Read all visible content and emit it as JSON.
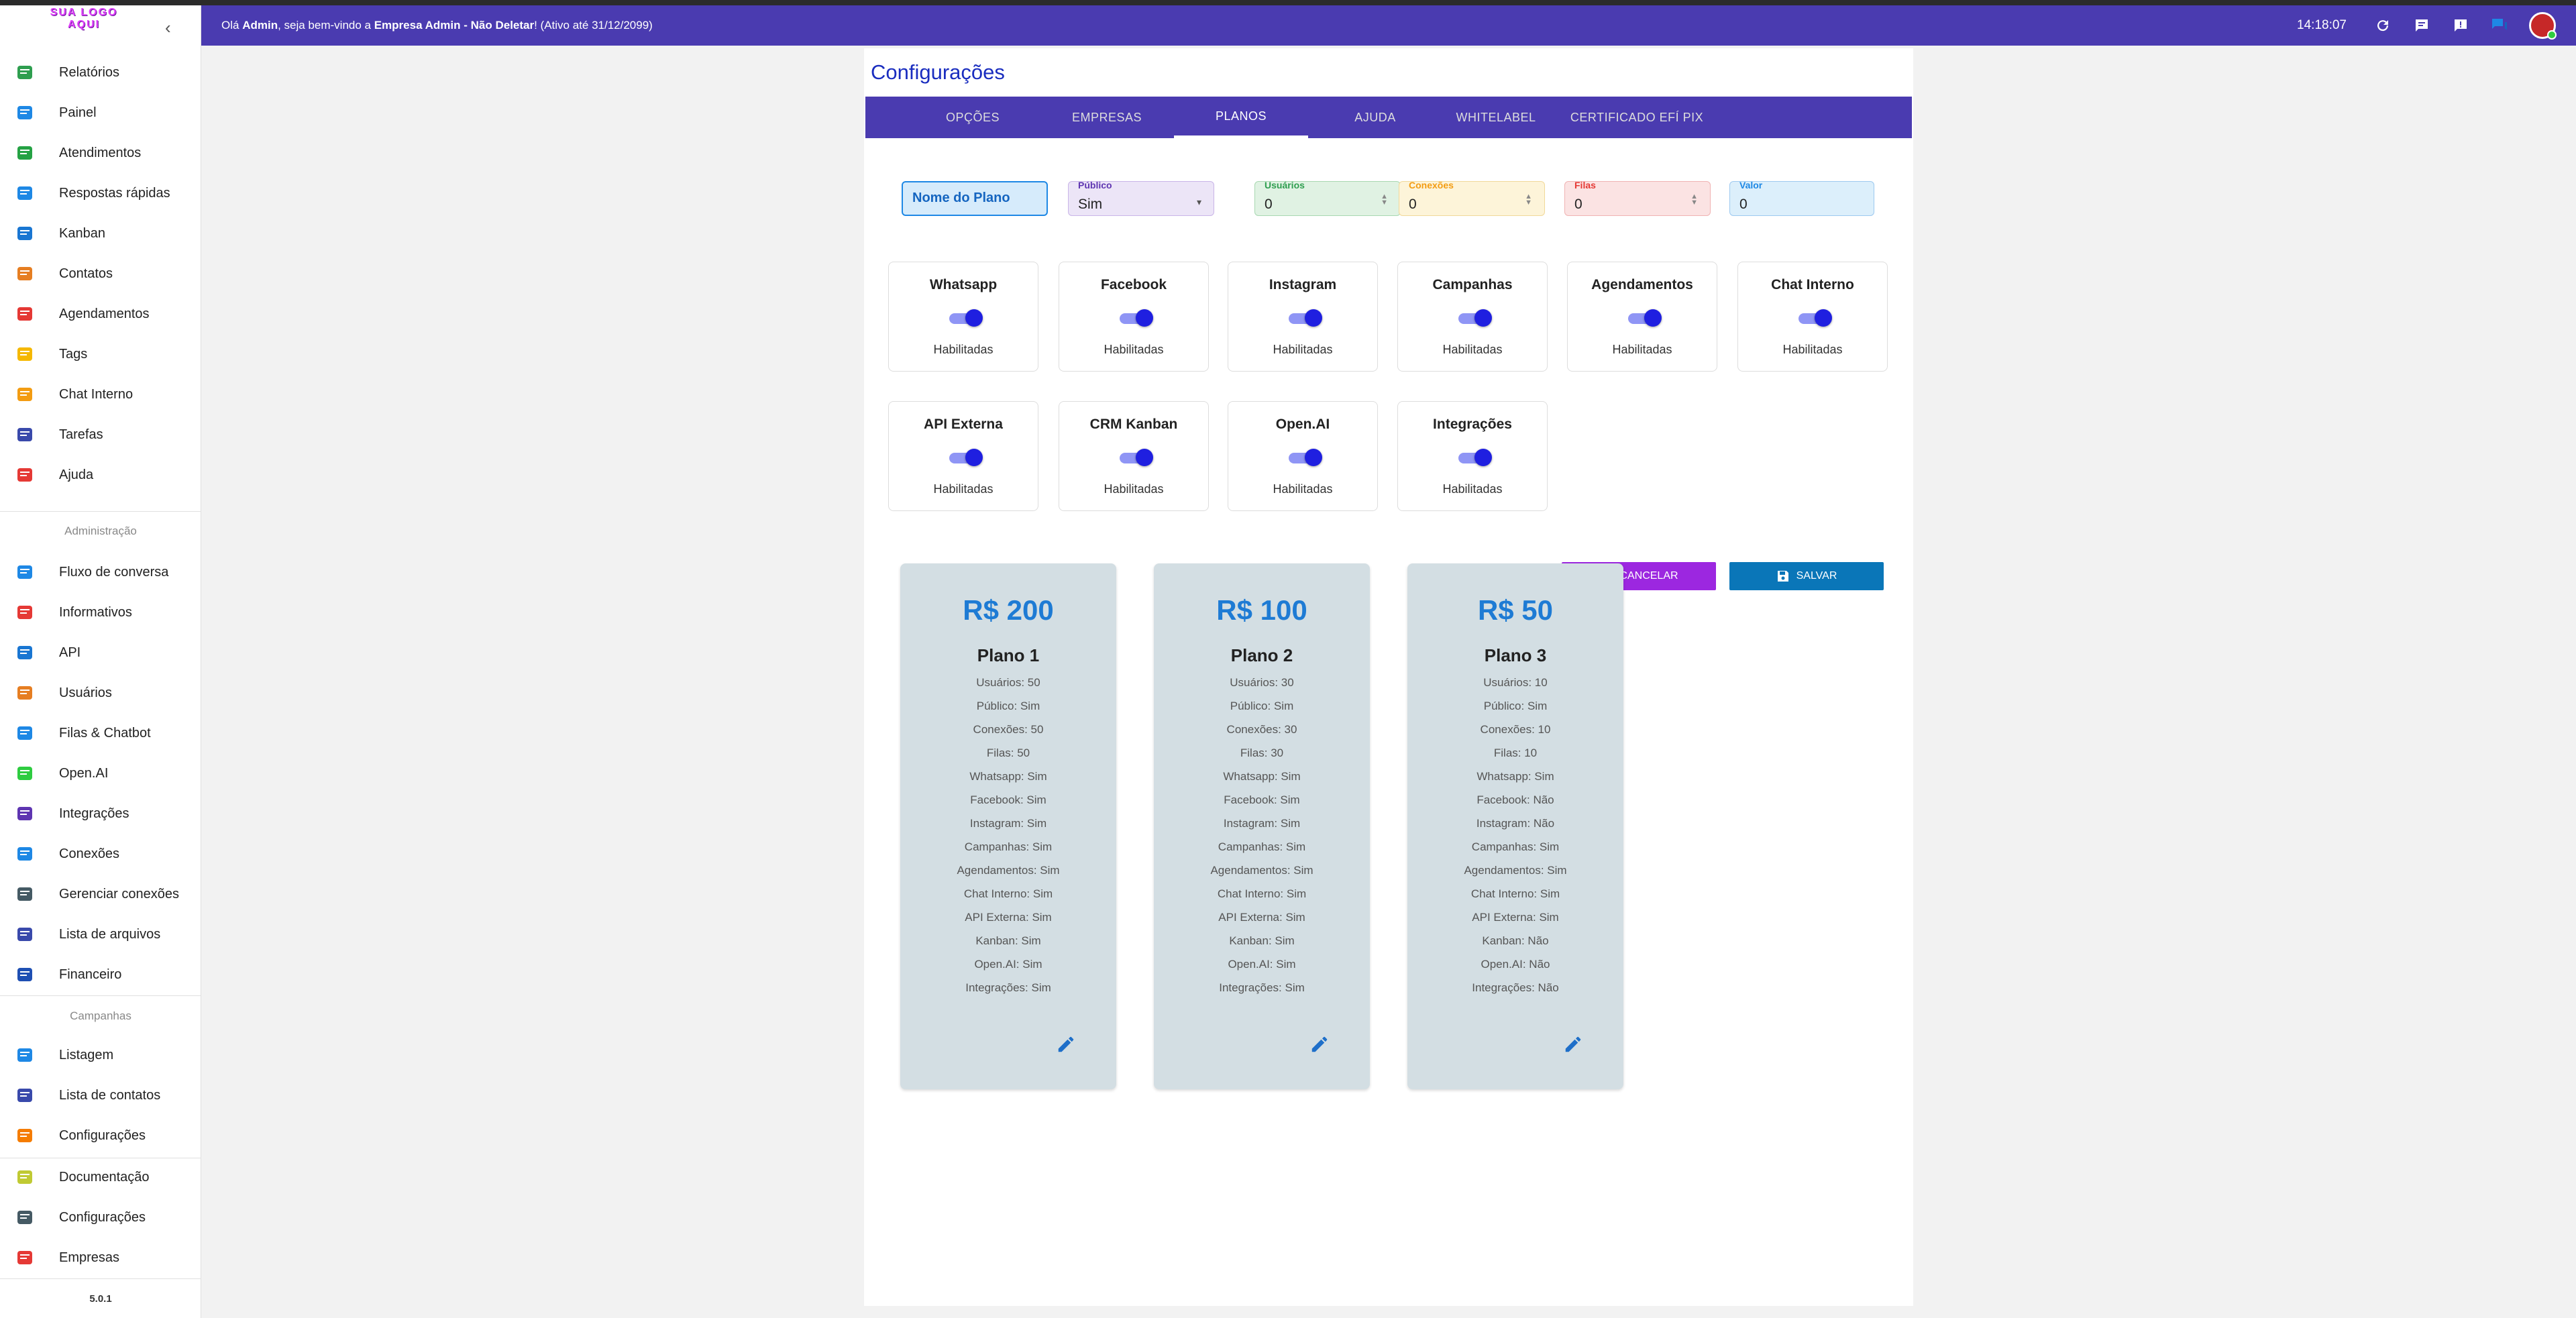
{
  "header": {
    "greeting_prefix": "Olá ",
    "user": "Admin",
    "greeting_mid": ", seja bem-vindo a ",
    "company": "Empresa Admin - Não Deletar",
    "greeting_suffix": "! (Ativo até 31/12/2099)",
    "time": "14:18:07"
  },
  "sidebar": {
    "logo_text": "SUA LOGO AQUI",
    "items": [
      {
        "label": "Relatórios",
        "icon": "report-icon",
        "color": "#2e9e4f"
      },
      {
        "label": "Painel",
        "icon": "grid-icon",
        "color": "#1e88e5"
      },
      {
        "label": "Atendimentos",
        "icon": "whatsapp-icon",
        "color": "#25a244"
      },
      {
        "label": "Respostas rápidas",
        "icon": "quick-reply-icon",
        "color": "#1e88e5"
      },
      {
        "label": "Kanban",
        "icon": "kanban-icon",
        "color": "#1976d2"
      },
      {
        "label": "Contatos",
        "icon": "contacts-icon",
        "color": "#e67e22"
      },
      {
        "label": "Agendamentos",
        "icon": "calendar-icon",
        "color": "#e53935"
      },
      {
        "label": "Tags",
        "icon": "tag-icon",
        "color": "#f5b800"
      },
      {
        "label": "Chat Interno",
        "icon": "chat-icon",
        "color": "#f39c12"
      },
      {
        "label": "Tarefas",
        "icon": "tasks-icon",
        "color": "#3949ab"
      },
      {
        "label": "Ajuda",
        "icon": "youtube-icon",
        "color": "#e53935"
      }
    ],
    "admin_section": "Administração",
    "admin_items": [
      {
        "label": "Fluxo de conversa",
        "icon": "flow-icon",
        "color": "#1e88e5"
      },
      {
        "label": "Informativos",
        "icon": "calendar-icon",
        "color": "#e53935"
      },
      {
        "label": "API",
        "icon": "api-icon",
        "color": "#1976d2"
      },
      {
        "label": "Usuários",
        "icon": "user-icon",
        "color": "#e67e22"
      },
      {
        "label": "Filas & Chatbot",
        "icon": "queue-icon",
        "color": "#1e88e5"
      },
      {
        "label": "Open.AI",
        "icon": "openai-icon",
        "color": "#2ecc40"
      },
      {
        "label": "Integrações",
        "icon": "integrations-icon",
        "color": "#5e35b1"
      },
      {
        "label": "Conexões",
        "icon": "wifi-icon",
        "color": "#1e88e5"
      },
      {
        "label": "Gerenciar conexões",
        "icon": "gear-icon",
        "color": "#455a64"
      },
      {
        "label": "Lista de arquivos",
        "icon": "files-icon",
        "color": "#3949ab"
      },
      {
        "label": "Financeiro",
        "icon": "qrcode-icon",
        "color": "#1e4fb3"
      }
    ],
    "campaign_section": "Campanhas",
    "campaign_items": [
      {
        "label": "Listagem",
        "icon": "mailbox-icon",
        "color": "#1e88e5"
      },
      {
        "label": "Lista de contatos",
        "icon": "clipboard-icon",
        "color": "#3949ab"
      },
      {
        "label": "Configurações",
        "icon": "gears-icon",
        "color": "#f57c00"
      }
    ],
    "bottom_items": [
      {
        "label": "Documentação",
        "icon": "doc-icon",
        "color": "#c0ca33"
      },
      {
        "label": "Configurações",
        "icon": "gear-icon",
        "color": "#455a64"
      },
      {
        "label": "Empresas",
        "icon": "home-icon",
        "color": "#e53935"
      }
    ],
    "version": "5.0.1"
  },
  "page": {
    "title": "Configurações",
    "tabs": [
      "OPÇÕES",
      "EMPRESAS",
      "PLANOS",
      "AJUDA",
      "WHITELABEL",
      "CERTIFICADO EFÍ PIX"
    ],
    "active_tab": "PLANOS"
  },
  "form": {
    "plan_name_placeholder": "Nome do Plano",
    "publico_label": "Público",
    "publico_value": "Sim",
    "usuarios_label": "Usuários",
    "usuarios_value": "0",
    "conexoes_label": "Conexões",
    "conexoes_value": "0",
    "filas_label": "Filas",
    "filas_value": "0",
    "valor_label": "Valor",
    "valor_value": "0"
  },
  "features": [
    {
      "name": "Whatsapp",
      "status": "Habilitadas",
      "enabled": true
    },
    {
      "name": "Facebook",
      "status": "Habilitadas",
      "enabled": true
    },
    {
      "name": "Instagram",
      "status": "Habilitadas",
      "enabled": true
    },
    {
      "name": "Campanhas",
      "status": "Habilitadas",
      "enabled": true
    },
    {
      "name": "Agendamentos",
      "status": "Habilitadas",
      "enabled": true
    },
    {
      "name": "Chat Interno",
      "status": "Habilitadas",
      "enabled": true
    },
    {
      "name": "API Externa",
      "status": "Habilitadas",
      "enabled": true
    },
    {
      "name": "CRM Kanban",
      "status": "Habilitadas",
      "enabled": true
    },
    {
      "name": "Open.AI",
      "status": "Habilitadas",
      "enabled": true
    },
    {
      "name": "Integrações",
      "status": "Habilitadas",
      "enabled": true
    }
  ],
  "buttons": {
    "cancel": "CANCELAR",
    "save": "SALVAR"
  },
  "plans": [
    {
      "price": "R$ 200",
      "name": "Plano 1",
      "lines": [
        "Usuários: 50",
        "Público: Sim",
        "Conexões: 50",
        "Filas: 50",
        "Whatsapp: Sim",
        "Facebook: Sim",
        "Instagram: Sim",
        "Campanhas: Sim",
        "Agendamentos: Sim",
        "Chat Interno: Sim",
        "API Externa: Sim",
        "Kanban: Sim",
        "Open.AI: Sim",
        "Integrações: Sim"
      ]
    },
    {
      "price": "R$ 100",
      "name": "Plano 2",
      "lines": [
        "Usuários: 30",
        "Público: Sim",
        "Conexões: 30",
        "Filas: 30",
        "Whatsapp: Sim",
        "Facebook: Sim",
        "Instagram: Sim",
        "Campanhas: Sim",
        "Agendamentos: Sim",
        "Chat Interno: Sim",
        "API Externa: Sim",
        "Kanban: Sim",
        "Open.AI: Sim",
        "Integrações: Sim"
      ]
    },
    {
      "price": "R$ 50",
      "name": "Plano 3",
      "lines": [
        "Usuários: 10",
        "Público: Sim",
        "Conexões: 10",
        "Filas: 10",
        "Whatsapp: Sim",
        "Facebook: Não",
        "Instagram: Não",
        "Campanhas: Sim",
        "Agendamentos: Sim",
        "Chat Interno: Sim",
        "API Externa: Sim",
        "Kanban: Não",
        "Open.AI: Não",
        "Integrações: Não"
      ]
    }
  ]
}
